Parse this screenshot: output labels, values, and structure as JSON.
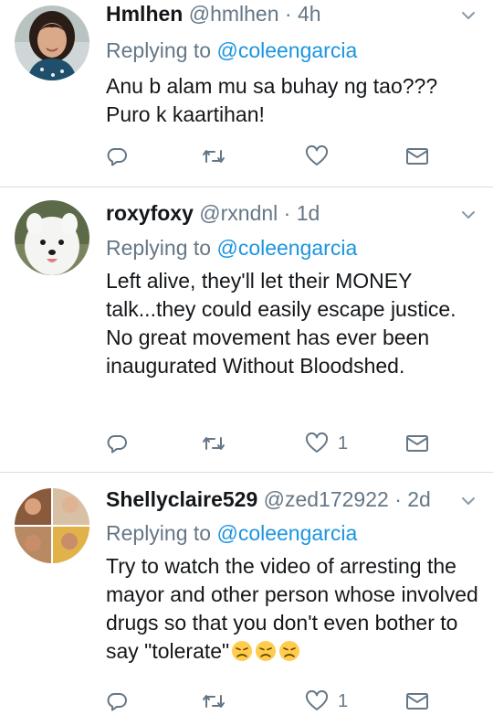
{
  "tweets": [
    {
      "name": "Hmlhen",
      "handle": "@hmlhen",
      "separator": "·",
      "time": "4h",
      "replying_prefix": "Replying to ",
      "replying_to": "@coleengarcia",
      "text": "Anu b alam mu sa buhay ng tao??? Puro k kaartihan!",
      "like_count": ""
    },
    {
      "name": "roxyfoxy",
      "handle": "@rxndnl",
      "separator": "·",
      "time": "1d",
      "replying_prefix": "Replying to ",
      "replying_to": "@coleengarcia",
      "text": "Left alive, they'll let their MONEY talk...they could easily escape justice. No great movement has ever been inaugurated Without Bloodshed.",
      "like_count": "1"
    },
    {
      "name": "Shellyclaire529",
      "handle": "@zed172922",
      "separator": "·",
      "time": "2d",
      "replying_prefix": "Replying to ",
      "replying_to": "@coleengarcia",
      "text": "Try to watch the video of arresting the mayor and other person whose involved drugs so that you don't even bother to say \"tolerate\"",
      "emojis": [
        "disappointed-face",
        "disappointed-face",
        "disappointed-face"
      ],
      "like_count": "1"
    }
  ],
  "icons": {
    "reply": "reply-icon",
    "retweet": "retweet-icon",
    "like": "heart-icon",
    "message": "envelope-icon",
    "menu": "chevron-down-icon"
  },
  "colors": {
    "link": "#1b95e0",
    "secondary_text": "#657786",
    "primary_text": "#14171a",
    "divider": "#d8dde2"
  }
}
